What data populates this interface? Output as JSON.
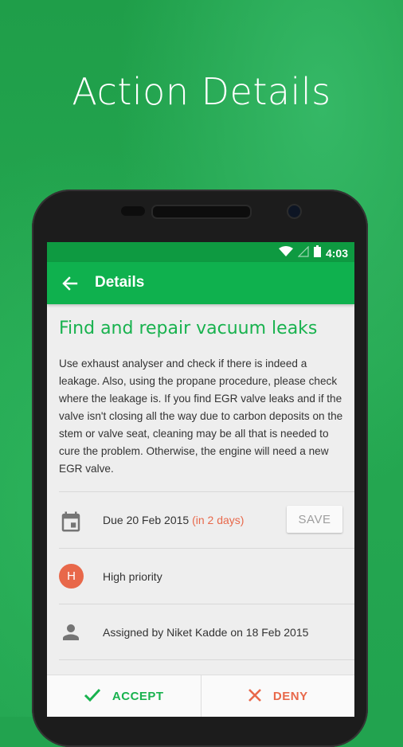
{
  "headline": "Action Details",
  "status_bar": {
    "time": "4:03",
    "icons": [
      "wifi-icon",
      "signal-icon",
      "battery-icon"
    ]
  },
  "app_bar": {
    "title": "Details",
    "back_icon": "arrow-back-icon"
  },
  "action": {
    "title": "Find and repair vacuum leaks",
    "description": "Use exhaust analyser and check if there is indeed a leakage. Also, using the propane procedure, please check where the leakage is. If you find EGR valve leaks and if the valve isn't closing all the way due to carbon deposits on the stem or valve seat, cleaning may be all that is needed to cure the problem. Otherwise, the engine will need a new EGR valve."
  },
  "due": {
    "text": "Due 20 Feb 2015",
    "relative": "(in 2 days)",
    "save_label": "SAVE",
    "icon": "calendar-icon"
  },
  "priority": {
    "badge": "H",
    "text": "High priority"
  },
  "assigned": {
    "text": "Assigned by Niket Kadde on 18 Feb 2015",
    "icon": "person-icon"
  },
  "actions": {
    "accept_label": "ACCEPT",
    "deny_label": "DENY"
  },
  "colors": {
    "accent": "#18b24e",
    "app_bar": "#0fb14e",
    "status_bar": "#0e9a41",
    "warning": "#e8684a"
  }
}
